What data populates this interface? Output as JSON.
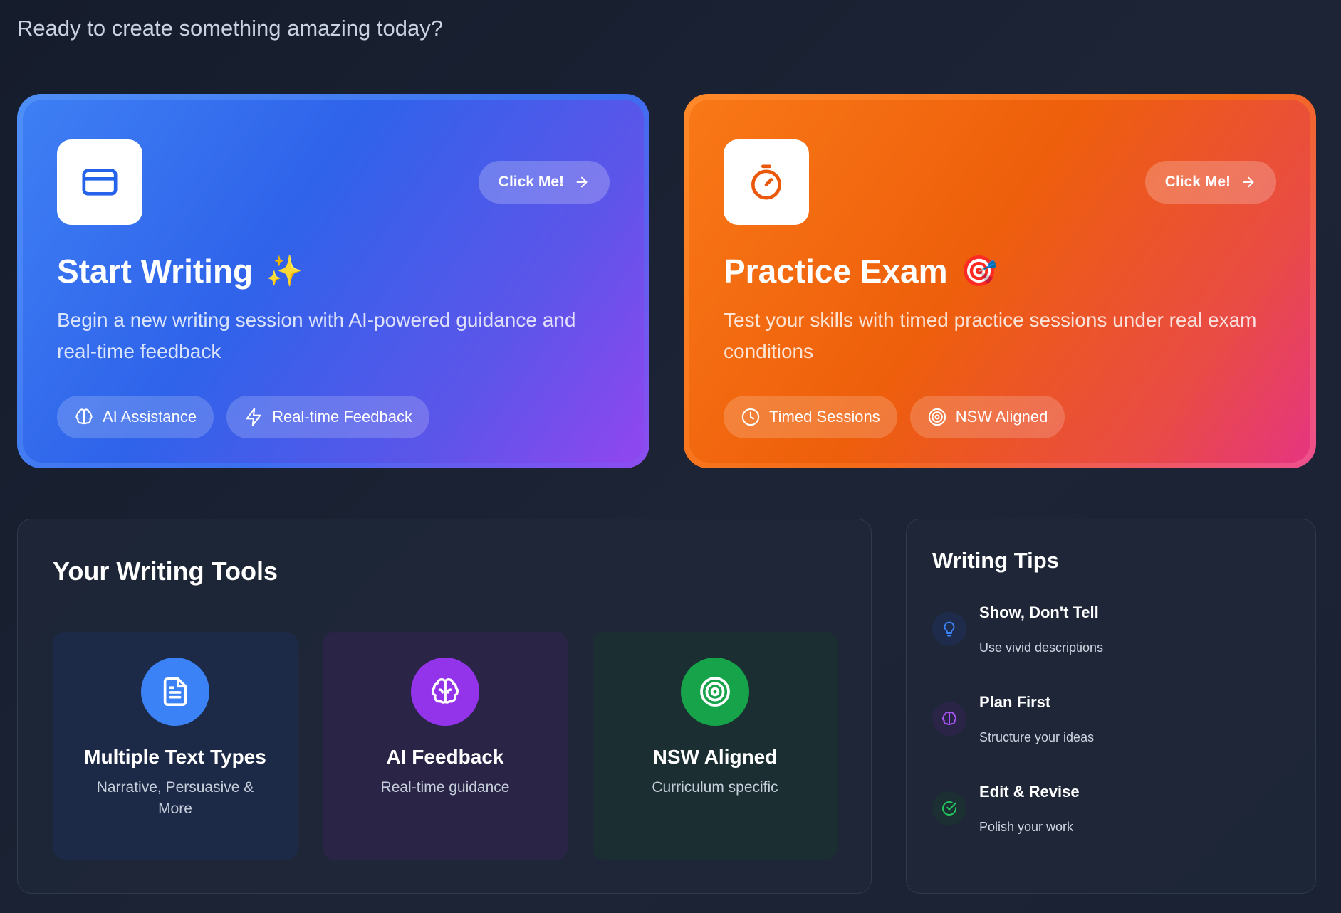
{
  "welcome": "Ready to create something amazing today?",
  "hero_cards": [
    {
      "title": "Start Writing",
      "emoji": "✨",
      "icon": "card-icon",
      "button_label": "Click Me!",
      "description": "Begin a new writing session with AI-powered guidance and real-time feedback",
      "chips": [
        {
          "label": "AI Assistance",
          "icon": "brain-icon"
        },
        {
          "label": "Real-time Feedback",
          "icon": "lightning-icon"
        }
      ],
      "accent": "#2563eb"
    },
    {
      "title": "Practice Exam",
      "emoji": "🎯",
      "icon": "timer-icon",
      "button_label": "Click Me!",
      "description": "Test your skills with timed practice sessions under real exam conditions",
      "chips": [
        {
          "label": "Timed Sessions",
          "icon": "clock-icon"
        },
        {
          "label": "NSW Aligned",
          "icon": "target-icon"
        }
      ],
      "accent": "#ea580c"
    }
  ],
  "tools": {
    "title": "Your Writing Tools",
    "items": [
      {
        "name": "Multiple Text Types",
        "subtitle": "Narrative, Persuasive & More",
        "icon": "document-icon",
        "color": "#3b82f6",
        "bg": "#1c2a47"
      },
      {
        "name": "AI Feedback",
        "subtitle": "Real-time guidance",
        "icon": "brain-icon",
        "color": "#9333ea",
        "bg": "#2a2547"
      },
      {
        "name": "NSW Aligned",
        "subtitle": "Curriculum specific",
        "icon": "target-icon",
        "color": "#16a34a",
        "bg": "#1b2f33"
      }
    ]
  },
  "tips": {
    "title": "Writing Tips",
    "items": [
      {
        "title": "Show, Don't Tell",
        "subtitle": "Use vivid descriptions",
        "icon": "lightbulb-icon",
        "color": "#3b82f6",
        "bg": "#1f2b4a"
      },
      {
        "title": "Plan First",
        "subtitle": "Structure your ideas",
        "icon": "brain-icon",
        "color": "#a855f7",
        "bg": "#2a2547"
      },
      {
        "title": "Edit & Revise",
        "subtitle": "Polish your work",
        "icon": "check-circle-icon",
        "color": "#22c55e",
        "bg": "#1c2f33"
      }
    ]
  }
}
